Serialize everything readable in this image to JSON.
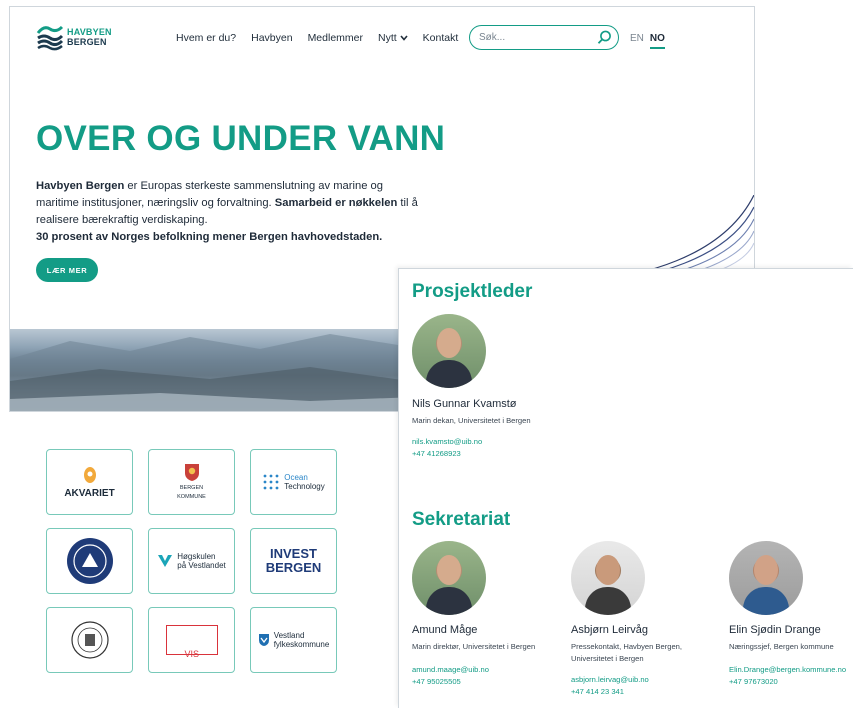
{
  "site": {
    "logo": {
      "line1": "HAVBYEN",
      "line2": "BERGEN"
    },
    "nav": [
      "Hvem er du?",
      "Havbyen",
      "Medlemmer",
      "Nytt",
      "Kontakt"
    ],
    "search": {
      "placeholder": "Søk..."
    },
    "lang": {
      "en": "EN",
      "no": "NO"
    },
    "hero": {
      "title": "OVER OG UNDER VANN",
      "p1_bold": "Havbyen Bergen",
      "p1_rest": " er Europas sterkeste sammenslutning av marine og maritime institusjoner, næringsliv og forvaltning. ",
      "p1_bold2": "Samarbeid er nøkkelen",
      "p1_end": " til å realisere bærekraftig verdiskaping.",
      "p2": "30 prosent av Norges befolkning mener Bergen havhovedstaden.",
      "cta": "LÆR MER"
    }
  },
  "partners": [
    {
      "name": "AKVARIET",
      "sub": ""
    },
    {
      "name": "BERGEN",
      "sub": "KOMMUNE"
    },
    {
      "name": "Ocean",
      "sub": "Technology"
    },
    {
      "name": "",
      "sub": ""
    },
    {
      "name": "Høgskulen",
      "sub": "på Vestlandet"
    },
    {
      "name": "INVEST",
      "sub": "BERGEN"
    },
    {
      "name": "",
      "sub": ""
    },
    {
      "name": "VIS",
      "sub": ""
    },
    {
      "name": "Vestland",
      "sub": "fylkeskommune"
    }
  ],
  "team": {
    "leader_heading": "Prosjektleder",
    "secretariat_heading": "Sekretariat",
    "leader": {
      "name": "Nils Gunnar Kvamstø",
      "role": "Marin dekan, Universitetet i Bergen",
      "email": "nils.kvamsto@uib.no",
      "phone": "+47 41268923"
    },
    "members": [
      {
        "name": "Amund Måge",
        "role": "Marin direktør, Universitetet i Bergen",
        "email": "amund.maage@uib.no",
        "phone": "+47 95025505"
      },
      {
        "name": "Asbjørn Leirvåg",
        "role": "Pressekontakt, Havbyen Bergen, Universitetet i Bergen",
        "email": "asbjorn.leirvag@uib.no",
        "phone": "+47 414 23 341"
      },
      {
        "name": "Elin Sjødin Drange",
        "role": "Næringssjef, Bergen kommune",
        "email": "Elin.Drange@bergen.kommune.no",
        "phone": "+47 97673020"
      }
    ]
  },
  "colors": {
    "accent": "#139c86",
    "text": "#1e2a38",
    "border": "#78c9b9"
  }
}
